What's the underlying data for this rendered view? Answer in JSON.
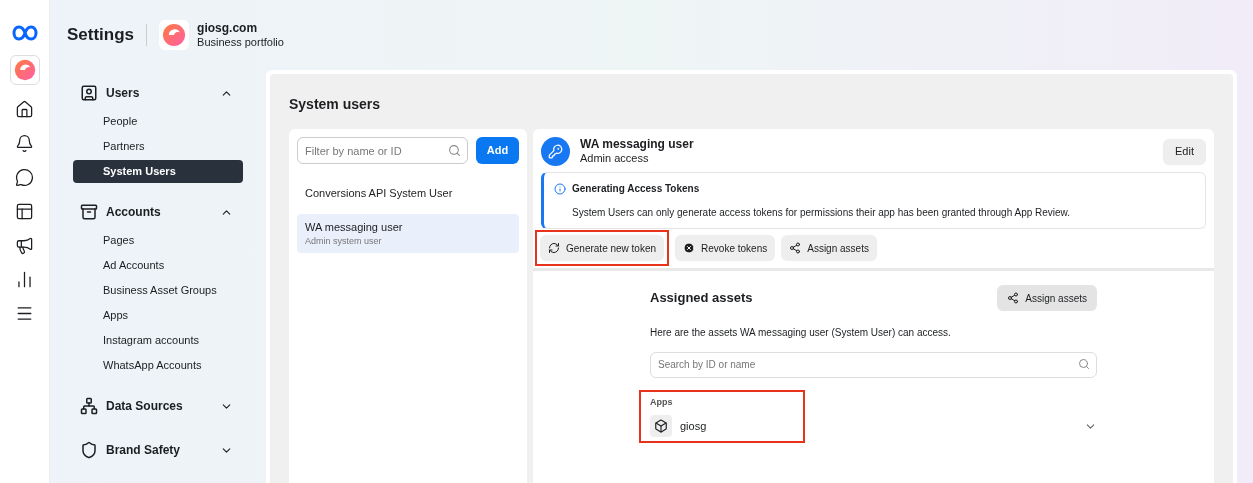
{
  "header": {
    "title": "Settings",
    "portfolio_name": "giosg.com",
    "portfolio_type": "Business portfolio"
  },
  "sidebar": {
    "sections": [
      {
        "label": "Users",
        "kind": "users",
        "expanded": true,
        "items": [
          {
            "label": "People",
            "selected": false
          },
          {
            "label": "Partners",
            "selected": false
          },
          {
            "label": "System Users",
            "selected": true
          }
        ]
      },
      {
        "label": "Accounts",
        "kind": "accounts",
        "expanded": true,
        "items": [
          {
            "label": "Pages",
            "selected": false
          },
          {
            "label": "Ad Accounts",
            "selected": false
          },
          {
            "label": "Business Asset Groups",
            "selected": false
          },
          {
            "label": "Apps",
            "selected": false
          },
          {
            "label": "Instagram accounts",
            "selected": false
          },
          {
            "label": "WhatsApp Accounts",
            "selected": false
          }
        ]
      },
      {
        "label": "Data Sources",
        "kind": "data",
        "expanded": false
      },
      {
        "label": "Brand Safety",
        "kind": "shield",
        "expanded": false
      }
    ]
  },
  "page_title": "System users",
  "user_list": {
    "filter": {
      "placeholder": "Filter by name or ID"
    },
    "add_button": "Add",
    "users": [
      {
        "name": "Conversions API System User",
        "selected": false
      },
      {
        "name": "WA messaging user",
        "role": "Admin system user",
        "selected": true
      }
    ]
  },
  "detail": {
    "name": "WA messaging user",
    "access": "Admin access",
    "edit_button": "Edit",
    "notice": {
      "title": "Generating Access Tokens",
      "text": "System Users can only generate access tokens for permissions their app has been granted through App Review."
    },
    "actions": [
      {
        "label": "Generate new token",
        "kind": "refresh",
        "highlighted": true
      },
      {
        "label": "Revoke tokens",
        "kind": "revoke",
        "highlighted": false
      },
      {
        "label": "Assign assets",
        "kind": "assign",
        "highlighted": false
      }
    ],
    "assets": {
      "title": "Assigned assets",
      "assign_button": "Assign assets",
      "description": "Here are the assets WA messaging user (System User) can access.",
      "search": {
        "placeholder": "Search by ID or name"
      },
      "groups": [
        {
          "label": "Apps",
          "highlighted": true,
          "items": [
            {
              "name": "giosg"
            }
          ]
        }
      ]
    }
  }
}
